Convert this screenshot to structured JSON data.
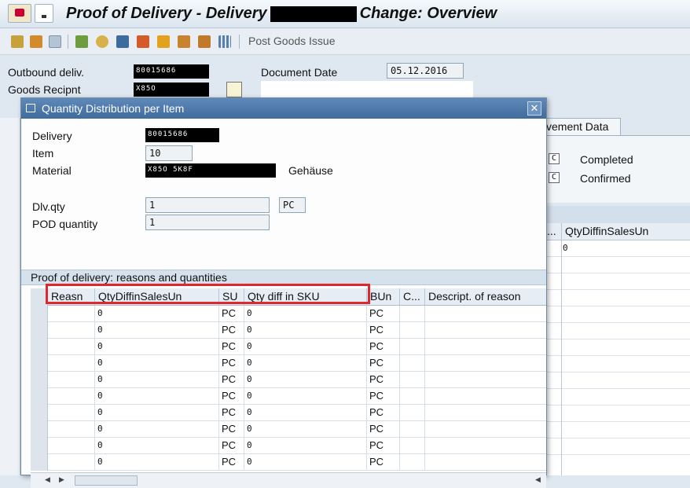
{
  "window": {
    "title_prefix": "Proof of Delivery - Delivery",
    "title_redacted": "",
    "title_suffix": "Change: Overview"
  },
  "toolbar": {
    "post_goods_issue_label": "Post Goods Issue"
  },
  "header": {
    "outbound_deliv_label": "Outbound deliv.",
    "outbound_deliv_value": "80015686",
    "goods_recipient_label": "Goods Recipnt",
    "goods_recipient_value": "X85O",
    "document_date_label": "Document Date",
    "document_date_value": "05.12.2016"
  },
  "background": {
    "tab_label": "vement Data",
    "status_1_flag": "C",
    "status_1_label": "Completed",
    "status_2_flag": "C",
    "status_2_label": "Confirmed",
    "col_ellipsis": "...",
    "col_qtydiff": "QtyDiffinSalesUn",
    "row1_value": "0"
  },
  "dialog": {
    "title": "Quantity Distribution per Item",
    "close_glyph": "✕",
    "delivery_label": "Delivery",
    "delivery_value": "80015686",
    "item_label": "Item",
    "item_value": "10",
    "material_label": "Material",
    "material_value": "X85O 5K8F",
    "material_desc": "Gehäuse",
    "dlv_qty_label": "Dlv.qty",
    "dlv_qty_value": "1",
    "dlv_qty_unit": "PC",
    "pod_qty_label": "POD quantity",
    "pod_qty_value": "1",
    "section_title": "Proof of delivery: reasons and quantities"
  },
  "grid": {
    "columns": {
      "reasn": "Reasn",
      "qtydiff_sales": "QtyDiffinSalesUn",
      "su": "SU",
      "qtydiff_sku": "Qty diff in SKU",
      "bun": "BUn",
      "c": "C...",
      "desc": "Descript. of reason"
    },
    "rows": [
      {
        "reasn": "",
        "qtydiff_sales": "0",
        "su": "PC",
        "qtydiff_sku": "0",
        "bun": "PC",
        "c": "",
        "desc": ""
      },
      {
        "reasn": "",
        "qtydiff_sales": "0",
        "su": "PC",
        "qtydiff_sku": "0",
        "bun": "PC",
        "c": "",
        "desc": ""
      },
      {
        "reasn": "",
        "qtydiff_sales": "0",
        "su": "PC",
        "qtydiff_sku": "0",
        "bun": "PC",
        "c": "",
        "desc": ""
      },
      {
        "reasn": "",
        "qtydiff_sales": "0",
        "su": "PC",
        "qtydiff_sku": "0",
        "bun": "PC",
        "c": "",
        "desc": ""
      },
      {
        "reasn": "",
        "qtydiff_sales": "0",
        "su": "PC",
        "qtydiff_sku": "0",
        "bun": "PC",
        "c": "",
        "desc": ""
      },
      {
        "reasn": "",
        "qtydiff_sales": "0",
        "su": "PC",
        "qtydiff_sku": "0",
        "bun": "PC",
        "c": "",
        "desc": ""
      },
      {
        "reasn": "",
        "qtydiff_sales": "0",
        "su": "PC",
        "qtydiff_sku": "0",
        "bun": "PC",
        "c": "",
        "desc": ""
      },
      {
        "reasn": "",
        "qtydiff_sales": "0",
        "su": "PC",
        "qtydiff_sku": "0",
        "bun": "PC",
        "c": "",
        "desc": ""
      },
      {
        "reasn": "",
        "qtydiff_sales": "0",
        "su": "PC",
        "qtydiff_sku": "0",
        "bun": "PC",
        "c": "",
        "desc": ""
      },
      {
        "reasn": "",
        "qtydiff_sales": "0",
        "su": "PC",
        "qtydiff_sku": "0",
        "bun": "PC",
        "c": "",
        "desc": ""
      }
    ]
  },
  "colors": {
    "highlight_border": "#e0262e",
    "dialog_title_bg": "#4a77a8"
  },
  "icons": [
    "sap-logo-icon",
    "menu-icon",
    "display-change-icon",
    "copy-icon",
    "delete-icon",
    "goods-movement-icon",
    "partner-icon",
    "print-icon",
    "status-icon",
    "freight-icon",
    "output-icon",
    "dates-icon",
    "grid-icon"
  ]
}
